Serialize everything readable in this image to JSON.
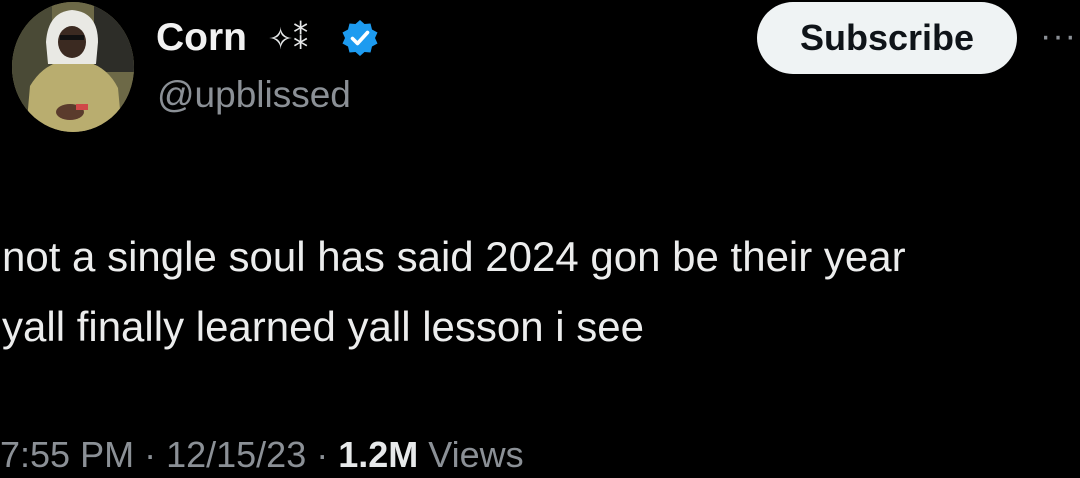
{
  "author": {
    "display_name": "Corn",
    "name_decoration": "✧⁑",
    "handle": "@upblissed",
    "verified": true,
    "avatar_icon": "profile-photo"
  },
  "actions": {
    "subscribe_label": "Subscribe",
    "more_label": "···"
  },
  "tweet": {
    "lines": [
      "not a single soul has said 2024 gon be their year",
      "yall finally learned yall lesson i see"
    ]
  },
  "meta": {
    "time": "7:55 PM",
    "separator": " · ",
    "date": "12/15/23",
    "views_count": "1.2M",
    "views_label": " Views"
  },
  "colors": {
    "background": "#000000",
    "text": "#e7e9ea",
    "secondary": "#8b9096",
    "verified_blue": "#1d9bf0",
    "button_bg": "#eff3f4"
  }
}
